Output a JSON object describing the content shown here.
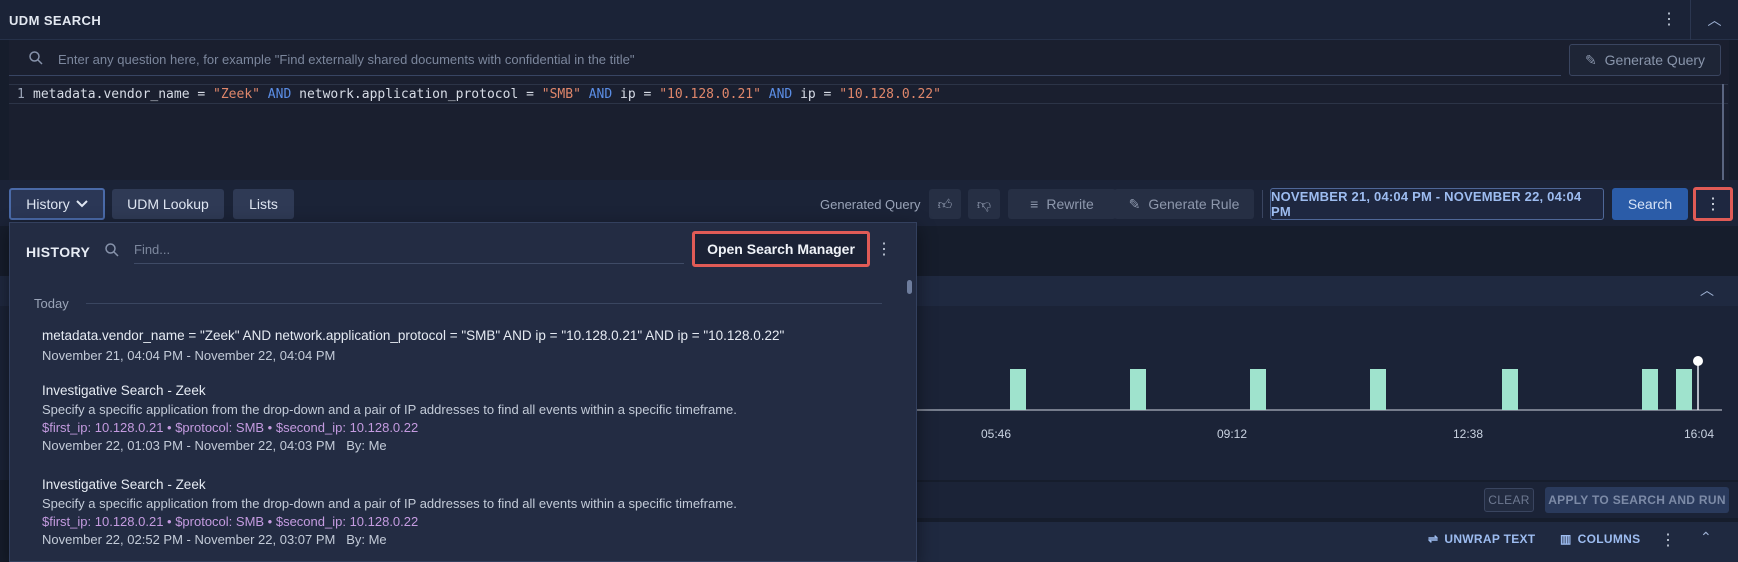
{
  "header": {
    "title": "UDM SEARCH",
    "kebab_icon": "kebab-icon",
    "collapse_icon": "chevron-up-icon"
  },
  "nl_search": {
    "placeholder": "Enter any question here, for example \"Find externally shared documents with confidential in the title\"",
    "generate_label": "Generate Query"
  },
  "query": {
    "line_number": "1",
    "tokens": [
      {
        "t": "metadata.vendor_name = ",
        "c": "f"
      },
      {
        "t": "\"Zeek\"",
        "c": "s"
      },
      {
        "t": " AND ",
        "c": "k"
      },
      {
        "t": "network.application_protocol = ",
        "c": "f"
      },
      {
        "t": "\"SMB\"",
        "c": "s"
      },
      {
        "t": " AND ",
        "c": "k"
      },
      {
        "t": "ip = ",
        "c": "f"
      },
      {
        "t": "\"10.128.0.21\"",
        "c": "s"
      },
      {
        "t": " AND ",
        "c": "k"
      },
      {
        "t": "ip = ",
        "c": "f"
      },
      {
        "t": "\"10.128.0.22\"",
        "c": "s"
      }
    ]
  },
  "toolbar": {
    "history_label": "History",
    "udm_lookup_label": "UDM Lookup",
    "lists_label": "Lists",
    "generated_query_label": "Generated Query",
    "rewrite_label": "Rewrite",
    "generate_rule_label": "Generate Rule",
    "date_range": "NOVEMBER 21, 04:04 PM - NOVEMBER 22, 04:04 PM",
    "search_label": "Search"
  },
  "history": {
    "title": "HISTORY",
    "find_placeholder": "Find...",
    "open_manager_label": "Open Search Manager",
    "group_label": "Today",
    "items": [
      {
        "title": "metadata.vendor_name = \"Zeek\" AND network.application_protocol = \"SMB\" AND ip = \"10.128.0.21\" AND ip = \"10.128.0.22\"",
        "date": "November 21, 04:04 PM - November 22, 04:04 PM"
      },
      {
        "title": "Investigative Search - Zeek",
        "desc": "Specify a specific application from the drop-down and a pair of IP addresses to find all events within a specific timeframe.",
        "params": "$first_ip: 10.128.0.21 • $protocol: SMB • $second_ip: 10.128.0.22",
        "date": "November 22, 01:03 PM - November 22, 04:03 PM   By: Me"
      },
      {
        "title": "Investigative Search - Zeek",
        "desc": "Specify a specific application from the drop-down and a pair of IP addresses to find all events within a specific timeframe.",
        "params": "$first_ip: 10.128.0.21 • $protocol: SMB • $second_ip: 10.128.0.22",
        "date": "November 22, 02:52 PM - November 22, 03:07 PM   By: Me"
      }
    ]
  },
  "timeline": {
    "tick_labels": [
      "05:46",
      "09:12",
      "12:38",
      "16:04"
    ],
    "bar_color": "#9fe3cd"
  },
  "filters": {
    "clear_label": "CLEAR",
    "apply_label": "APPLY TO SEARCH AND RUN"
  },
  "results": {
    "unwrap_label": "UNWRAP TEXT",
    "columns_label": "COLUMNS"
  },
  "colors": {
    "accent": "#2b5ca8",
    "highlight": "#e05b56",
    "param": "#c49be0"
  }
}
